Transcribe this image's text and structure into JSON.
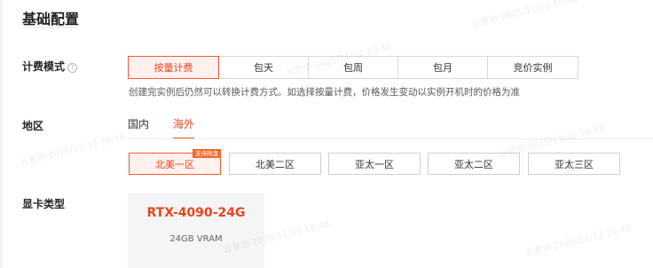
{
  "section": {
    "title": "基础配置"
  },
  "billing": {
    "label": "计费模式",
    "help_icon": "?",
    "options": [
      "按量计费",
      "包天",
      "包周",
      "包月",
      "竞价实例"
    ],
    "selected": "按量计费",
    "note": "创建完实例后仍然可以转换计费方式。如选择按量计费，价格发生变动以实例开机时的价格为准"
  },
  "region": {
    "label": "地区",
    "tabs": [
      "国内",
      "海外"
    ],
    "selected_tab": "海外",
    "zones": [
      "北美一区",
      "北美二区",
      "亚太一区",
      "亚太二区",
      "亚太三区"
    ],
    "selected_zone": "北美一区",
    "zone_badge": "支持网盘"
  },
  "gpu": {
    "label": "显卡类型",
    "name": "RTX-4090-24G",
    "memory": "24GB VRAM"
  },
  "watermark": "云意协·2025/11/12 10:48",
  "colors": {
    "accent": "#ef5a37",
    "accent_bg": "#fff1ed"
  }
}
